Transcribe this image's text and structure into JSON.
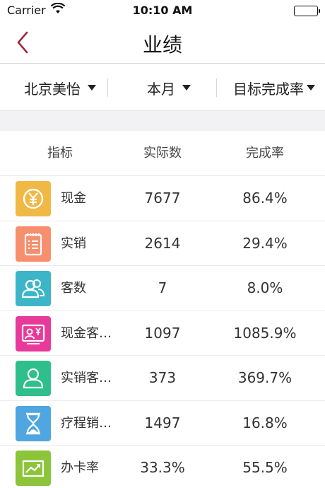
{
  "status_bar": {
    "carrier": "Carrier",
    "time": "10:10 AM"
  },
  "nav": {
    "title": "业绩"
  },
  "filters": [
    {
      "label": "北京美怡"
    },
    {
      "label": "本月"
    },
    {
      "label": "目标完成率"
    }
  ],
  "table": {
    "headers": {
      "name": "指标",
      "actual": "实际数",
      "rate": "完成率"
    },
    "rows": [
      {
        "name": "现金",
        "actual": "7677",
        "rate": "86.4%",
        "icon": "yuan-coin-icon",
        "color": "#F0B845"
      },
      {
        "name": "实销",
        "actual": "2614",
        "rate": "29.4%",
        "icon": "notepad-list-icon",
        "color": "#F78F6F"
      },
      {
        "name": "客数",
        "actual": "7",
        "rate": "8.0%",
        "icon": "users-icon",
        "color": "#3DB5C8"
      },
      {
        "name": "现金客…",
        "actual": "1097",
        "rate": "1085.9%",
        "icon": "yuan-person-card-icon",
        "color": "#E83A9A"
      },
      {
        "name": "实销客…",
        "actual": "373",
        "rate": "369.7%",
        "icon": "person-icon",
        "color": "#2FBF8C"
      },
      {
        "name": "疗程销…",
        "actual": "1497",
        "rate": "16.8%",
        "icon": "hourglass-icon",
        "color": "#4FA6E0"
      },
      {
        "name": "办卡率",
        "actual": "33.3%",
        "rate": "55.5%",
        "icon": "trend-chart-icon",
        "color": "#8CC43A"
      }
    ]
  },
  "colors": {
    "accent": "#A0283C"
  }
}
